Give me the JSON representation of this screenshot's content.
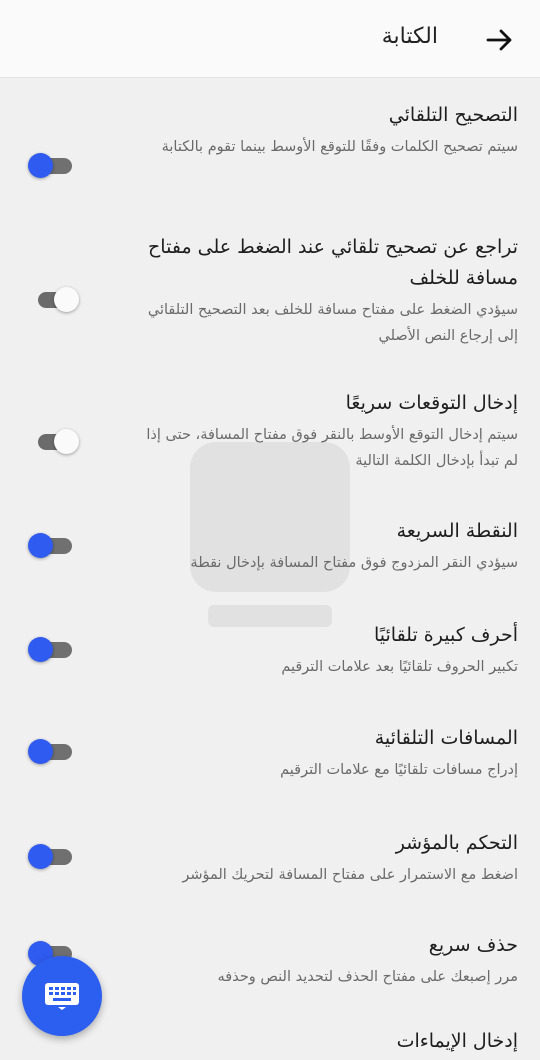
{
  "appbar": {
    "title": "الكتابة",
    "back_icon": "arrow-forward-icon"
  },
  "accent_color": "#2f5bf0",
  "settings": [
    {
      "title": "التصحيح التلقائي",
      "summary": "سيتم تصحيح الكلمات وفقًا للتوقع الأوسط بينما تقوم بالكتابة",
      "enabled": true
    },
    {
      "title": "تراجع عن تصحيح تلقائي عند الضغط على مفتاح مسافة للخلف",
      "summary": "سيؤدي الضغط على مفتاح مسافة للخلف بعد التصحيح التلقائي إلى إرجاع النص الأصلي",
      "enabled": false
    },
    {
      "title": "إدخال التوقعات سريعًا",
      "summary": "سيتم إدخال التوقع الأوسط بالنقر فوق مفتاح المسافة، حتى إذا لم تبدأ بإدخال الكلمة التالية",
      "enabled": false
    },
    {
      "title": "النقطة السريعة",
      "summary": "سيؤدي النقر المزدوج فوق مفتاح المسافة بإدخال نقطة",
      "enabled": true
    },
    {
      "title": "أحرف كبيرة تلقائيًا",
      "summary": "تكبير الحروف تلقائيًا بعد علامات الترقيم",
      "enabled": true
    },
    {
      "title": "المسافات التلقائية",
      "summary": "إدراج مسافات تلقائيًا مع علامات الترقيم",
      "enabled": true
    },
    {
      "title": "التحكم بالمؤشر",
      "summary": "اضغط مع الاستمرار على مفتاح المسافة لتحريك المؤشر",
      "enabled": true
    },
    {
      "title": "حذف سريع",
      "summary": "مرر إصبعك على مفتاح الحذف لتحديد النص وحذفه",
      "enabled": true
    },
    {
      "title": "إدخال الإيماءات",
      "summary": "",
      "enabled": true
    }
  ],
  "fab": {
    "icon": "keyboard-icon"
  }
}
